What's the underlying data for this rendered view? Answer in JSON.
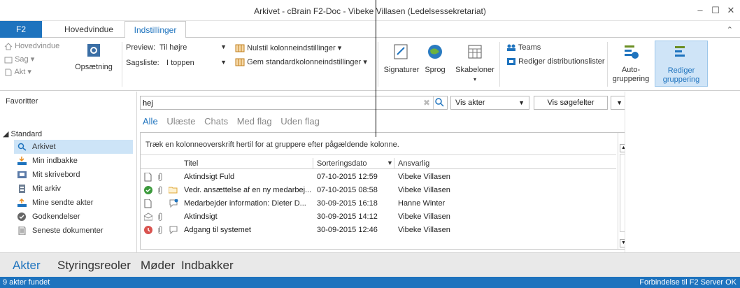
{
  "window": {
    "title": "Arkivet - cBrain F2-Doc - Vibeke Villasen (Ledelsessekretariat)",
    "minimize": "–",
    "maximize": "☐",
    "close": "✕"
  },
  "tabs": {
    "f2": "F2",
    "items": [
      "Hovedvindue",
      "Indstillinger"
    ],
    "active": "Indstillinger"
  },
  "ribbon": {
    "nav": {
      "hovedvindue": "Hovedvindue",
      "sag": "Sag",
      "akt": "Akt"
    },
    "opsaetning": "Opsætning",
    "preview_label": "Preview:",
    "preview_value": "Til højre",
    "sagsliste_label": "Sagsliste:",
    "sagsliste_value": "I toppen",
    "nulstil": "Nulstil kolonneindstillinger",
    "gem": "Gem standardkolonneindstillinger",
    "signaturer": "Signaturer",
    "sprog": "Sprog",
    "skabeloner": "Skabeloner",
    "teams": "Teams",
    "rediger_dist": "Rediger distributionslister",
    "auto_gruppering_1": "Auto-",
    "auto_gruppering_2": "gruppering",
    "rediger_gruppering_1": "Rediger",
    "rediger_gruppering_2": "gruppering"
  },
  "sidebar": {
    "favoritter": "Favoritter",
    "standard": "◢ Standard",
    "items": [
      {
        "label": "Arkivet",
        "icon": "search-icon"
      },
      {
        "label": "Min indbakke",
        "icon": "inbox-icon"
      },
      {
        "label": "Mit skrivebord",
        "icon": "desk-icon"
      },
      {
        "label": "Mit arkiv",
        "icon": "archive-icon"
      },
      {
        "label": "Mine sendte akter",
        "icon": "outbox-icon"
      },
      {
        "label": "Godkendelser",
        "icon": "check-icon"
      },
      {
        "label": "Seneste dokumenter",
        "icon": "document-icon"
      }
    ],
    "selected": "Arkivet"
  },
  "search": {
    "value": "hej",
    "vis_akter": "Vis akter",
    "vis_soegefelter": "Vis søgefelter"
  },
  "filters": [
    "Alle",
    "Ulæste",
    "Chats",
    "Med flag",
    "Uden flag"
  ],
  "grid": {
    "group_hint": "Træk en kolonneoverskrift hertil for at gruppere efter pågældende kolonne.",
    "columns": [
      "Titel",
      "Sorteringsdato",
      "Ansvarlig"
    ],
    "rows": [
      {
        "title": "Aktindsigt Fuld",
        "date": "07-10-2015 12:59",
        "owner": "Vibeke Villasen"
      },
      {
        "title": "Vedr. ansættelse af en ny medarbej...",
        "date": "07-10-2015 08:58",
        "owner": "Vibeke Villasen"
      },
      {
        "title": "Medarbejder information: Dieter D...",
        "date": "30-09-2015 16:18",
        "owner": "Hanne Winter"
      },
      {
        "title": "Aktindsigt",
        "date": "30-09-2015 14:12",
        "owner": "Vibeke Villasen"
      },
      {
        "title": "Adgang til systemet",
        "date": "30-09-2015 12:46",
        "owner": "Vibeke Villasen"
      }
    ]
  },
  "bottomnav": [
    "Akter",
    "Styringsreoler",
    "Møder",
    "Indbakker"
  ],
  "status": {
    "left": "9 akter fundet",
    "right": "Forbindelse til F2 Server OK"
  },
  "colors": {
    "accent": "#1e73be",
    "selected": "#cde4f7"
  }
}
